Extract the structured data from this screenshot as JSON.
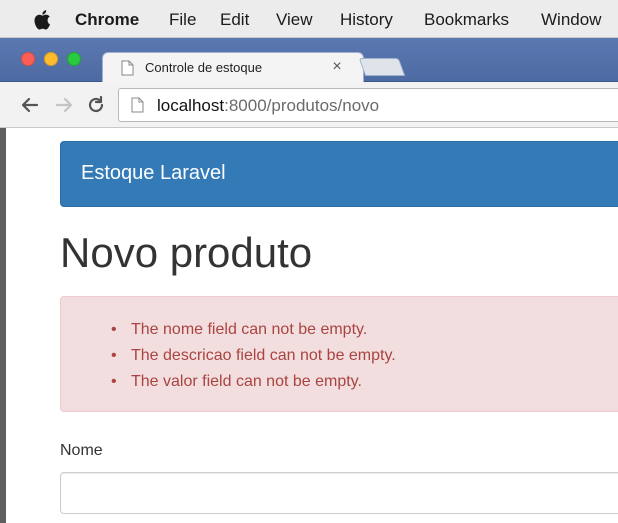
{
  "menubar": {
    "apple_icon": "apple-icon",
    "items": [
      "Chrome",
      "File",
      "Edit",
      "View",
      "History",
      "Bookmarks",
      "Window"
    ]
  },
  "browser": {
    "tab": {
      "title": "Controle de estoque",
      "favicon": "page-icon",
      "close_glyph": "×"
    },
    "omnibox": {
      "host": "localhost",
      "rest": ":8000/produtos/novo"
    },
    "colors": {
      "tabstrip": "#4e6aa3",
      "close": "#fc5f57",
      "minimize": "#fdbc2e",
      "maximize": "#29c940"
    }
  },
  "page": {
    "navbar": {
      "brand": "Estoque Laravel",
      "color": "#337ab7"
    },
    "title": "Novo produto",
    "alert": {
      "color": "#a94442",
      "background": "#f2dede",
      "errors": [
        "The nome field can not be empty.",
        "The descricao field can not be empty.",
        "The valor field can not be empty."
      ]
    },
    "form": {
      "nome_label": "Nome",
      "nome_value": ""
    }
  }
}
